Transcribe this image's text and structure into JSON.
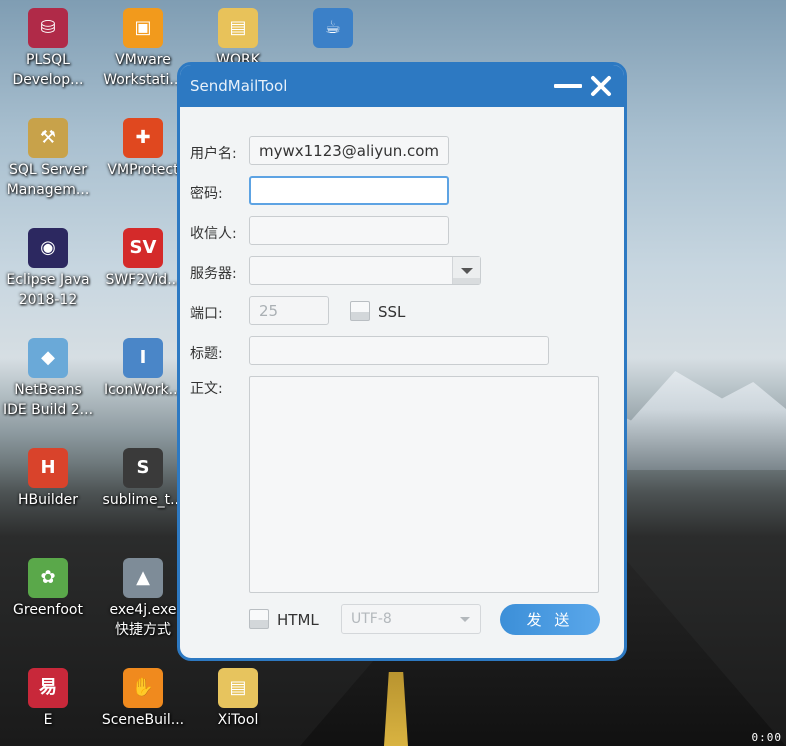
{
  "desktop": {
    "icons": [
      {
        "name": "plsql-developer",
        "label": "PLSQL\nDevelop...",
        "color": "#b02a48",
        "glyph": "⛁"
      },
      {
        "name": "vmware-workstation",
        "label": "VMware\nWorkstati...",
        "color": "#f29a1c",
        "glyph": "▣"
      },
      {
        "name": "work-folder",
        "label": "WORK",
        "color": "#e8c25a",
        "glyph": "▤"
      },
      {
        "name": "java-app",
        "label": "",
        "color": "#3b80c8",
        "glyph": "☕"
      },
      {
        "name": "sql-server-management",
        "label": "SQL Server\nManagem...",
        "color": "#c8a24a",
        "glyph": "⚒"
      },
      {
        "name": "vmprotect",
        "label": "VMProtect",
        "color": "#e0481f",
        "glyph": "✚"
      },
      {
        "name": "eclipse-java",
        "label": "Eclipse Java\n2018-12",
        "color": "#2c2860",
        "glyph": "◉"
      },
      {
        "name": "swf2video",
        "label": "SWF2Vid...",
        "color": "#d42a2a",
        "glyph": "SV"
      },
      {
        "name": "netbeans-ide",
        "label": "NetBeans\nIDE Build 2...",
        "color": "#6aa9d8",
        "glyph": "◆"
      },
      {
        "name": "iconworkshop",
        "label": "IconWork...",
        "color": "#4a86c8",
        "glyph": "I"
      },
      {
        "name": "hbuilder",
        "label": "HBuilder",
        "color": "#d9432b",
        "glyph": "H"
      },
      {
        "name": "sublime-text",
        "label": "sublime_t...",
        "color": "#3a3a3a",
        "glyph": "S"
      },
      {
        "name": "greenfoot",
        "label": "Greenfoot",
        "color": "#5aa84a",
        "glyph": "✿"
      },
      {
        "name": "exe4j",
        "label": "exe4j.exe\n快捷方式",
        "color": "#7e8c98",
        "glyph": "▲"
      },
      {
        "name": "e-language",
        "label": "E",
        "color": "#c8283a",
        "glyph": "易"
      },
      {
        "name": "scene-builder",
        "label": "SceneBuil...",
        "color": "#f08a1e",
        "glyph": "✋"
      },
      {
        "name": "xitool",
        "label": "XiTool",
        "color": "#e7c45e",
        "glyph": "▤"
      }
    ],
    "clock": "0:00"
  },
  "window": {
    "title": "SendMailTool",
    "form": {
      "username_label": "用户名:",
      "username_value": "mywx1123@aliyun.com",
      "password_label": "密码:",
      "password_value": "",
      "recipient_label": "收信人:",
      "recipient_value": "",
      "server_label": "服务器:",
      "server_value": "",
      "port_label": "端口:",
      "port_value": "25",
      "ssl_label": "SSL",
      "ssl_checked": false,
      "subject_label": "标题:",
      "subject_value": "",
      "body_label": "正文:",
      "body_value": "",
      "html_label": "HTML",
      "html_checked": false,
      "encoding_value": "UTF-8",
      "send_label": "发 送"
    }
  }
}
